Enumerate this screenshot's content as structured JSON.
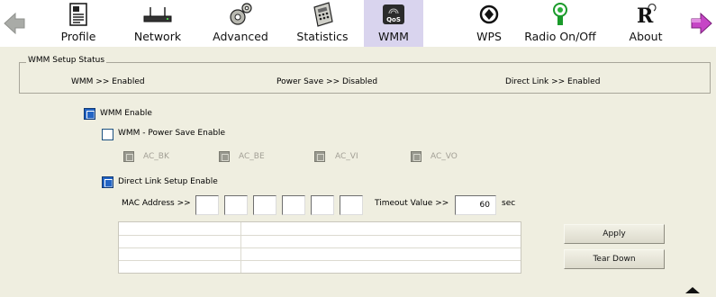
{
  "toolbar": {
    "items": [
      {
        "label": "Profile",
        "icon": "profile-icon"
      },
      {
        "label": "Network",
        "icon": "network-icon"
      },
      {
        "label": "Advanced",
        "icon": "advanced-icon"
      },
      {
        "label": "Statistics",
        "icon": "statistics-icon"
      },
      {
        "label": "WMM",
        "icon": "qos-icon",
        "icon_text": "QoS",
        "active": true
      },
      {
        "label": "WPS",
        "icon": "wps-icon"
      },
      {
        "label": "Radio On/Off",
        "icon": "radio-icon"
      },
      {
        "label": "About",
        "icon": "about-icon",
        "icon_text": "R"
      }
    ],
    "back_icon": "back-arrow-icon",
    "forward_icon": "forward-arrow-icon"
  },
  "status": {
    "legend": "WMM Setup Status",
    "wmm": "WMM >> Enabled",
    "power_save": "Power Save >> Disabled",
    "direct_link": "Direct Link >> Enabled"
  },
  "settings": {
    "wmm_enable": {
      "label": "WMM Enable",
      "checked": true
    },
    "power_save_enable": {
      "label": "WMM - Power Save Enable",
      "checked": false
    },
    "ac_bk": {
      "label": "AC_BK",
      "enabled": false
    },
    "ac_be": {
      "label": "AC_BE",
      "enabled": false
    },
    "ac_vi": {
      "label": "AC_VI",
      "enabled": false
    },
    "ac_vo": {
      "label": "AC_VO",
      "enabled": false
    },
    "dls_enable": {
      "label": "Direct Link Setup Enable",
      "checked": true
    },
    "mac_label": "MAC Address >>",
    "mac_octets": [
      "",
      "",
      "",
      "",
      "",
      ""
    ],
    "timeout_label": "Timeout Value >>",
    "timeout_value": "60",
    "timeout_unit": "sec"
  },
  "buttons": {
    "apply": "Apply",
    "tear_down": "Tear Down"
  },
  "colors": {
    "active_tab": "#d9d4ee",
    "panel_bg": "#efeee0",
    "checkbox_on": "#2364c4"
  }
}
